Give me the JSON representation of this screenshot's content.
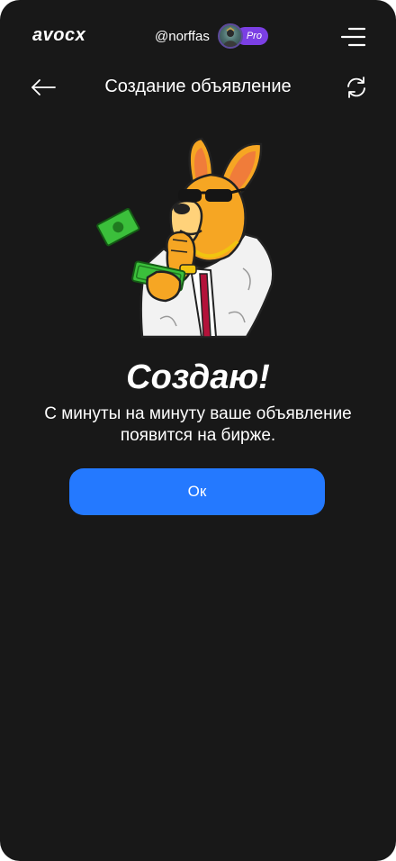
{
  "header": {
    "logo": "avocx",
    "username": "@norffas",
    "badge": "Pro",
    "menu_icon": "hamburger-menu-icon"
  },
  "nav": {
    "title": "Создание объявление",
    "back_icon": "arrow-left-icon",
    "refresh_icon": "refresh-icon"
  },
  "status": {
    "headline": "Создаю!",
    "message": "С минуты на минуту ваше объявление появится на бирже."
  },
  "actions": {
    "ok_label": "Ок"
  },
  "colors": {
    "background": "#181818",
    "accent": "#2479ff",
    "badge": "#7b3fe4"
  }
}
